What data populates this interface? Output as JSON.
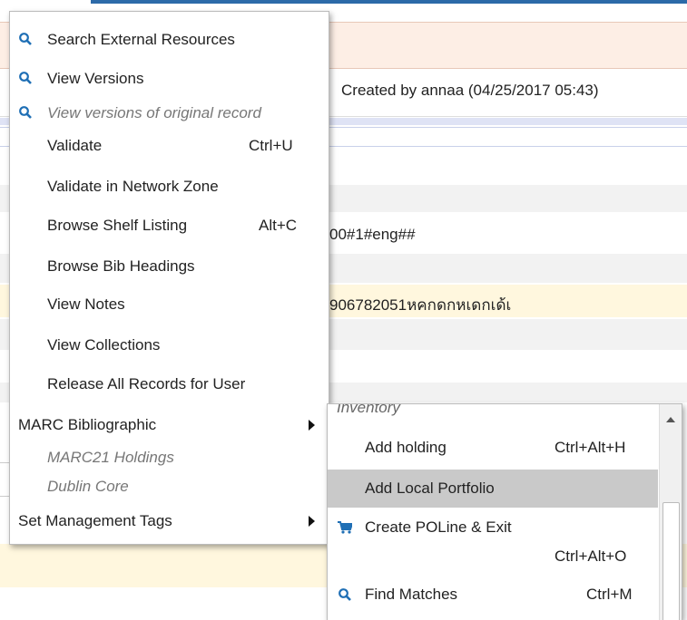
{
  "background": {
    "created_by": "Created by annaa (04/25/2017 05:43)",
    "field_008": "00#1#eng##",
    "field_020": "906782051หคกดกหเดกเด้เ"
  },
  "main_menu": {
    "items": [
      {
        "label": "Search External Resources",
        "icon": "search-icon"
      },
      {
        "label": "View Versions",
        "icon": "search-icon"
      },
      {
        "label": "View versions of original record",
        "icon": "search-icon"
      },
      {
        "label": "Validate",
        "shortcut": "Ctrl+U"
      },
      {
        "label": "Validate in Network Zone"
      },
      {
        "label": "Browse Shelf Listing",
        "shortcut": "Alt+C"
      },
      {
        "label": "Browse Bib Headings"
      },
      {
        "label": "View Notes"
      },
      {
        "label": "View Collections"
      },
      {
        "label": "Release All Records for User"
      },
      {
        "label": "MARC Bibliographic"
      },
      {
        "label": "MARC21 Holdings"
      },
      {
        "label": "Dublin Core"
      },
      {
        "label": "Set Management Tags"
      }
    ]
  },
  "submenu": {
    "section": "Inventory",
    "items": [
      {
        "label": "Add holding",
        "shortcut": "Ctrl+Alt+H"
      },
      {
        "label": "Add Local Portfolio"
      },
      {
        "label": "Create POLine & Exit",
        "shortcut": "Ctrl+Alt+O",
        "icon": "cart-icon"
      },
      {
        "label": "Find Matches",
        "shortcut": "Ctrl+M",
        "icon": "search-icon"
      }
    ]
  },
  "colors": {
    "accent": "#1f6fb5",
    "highlight": "#c9c9c9",
    "warning_row": "#fdeee5",
    "yellow_row": "#fff7de"
  }
}
